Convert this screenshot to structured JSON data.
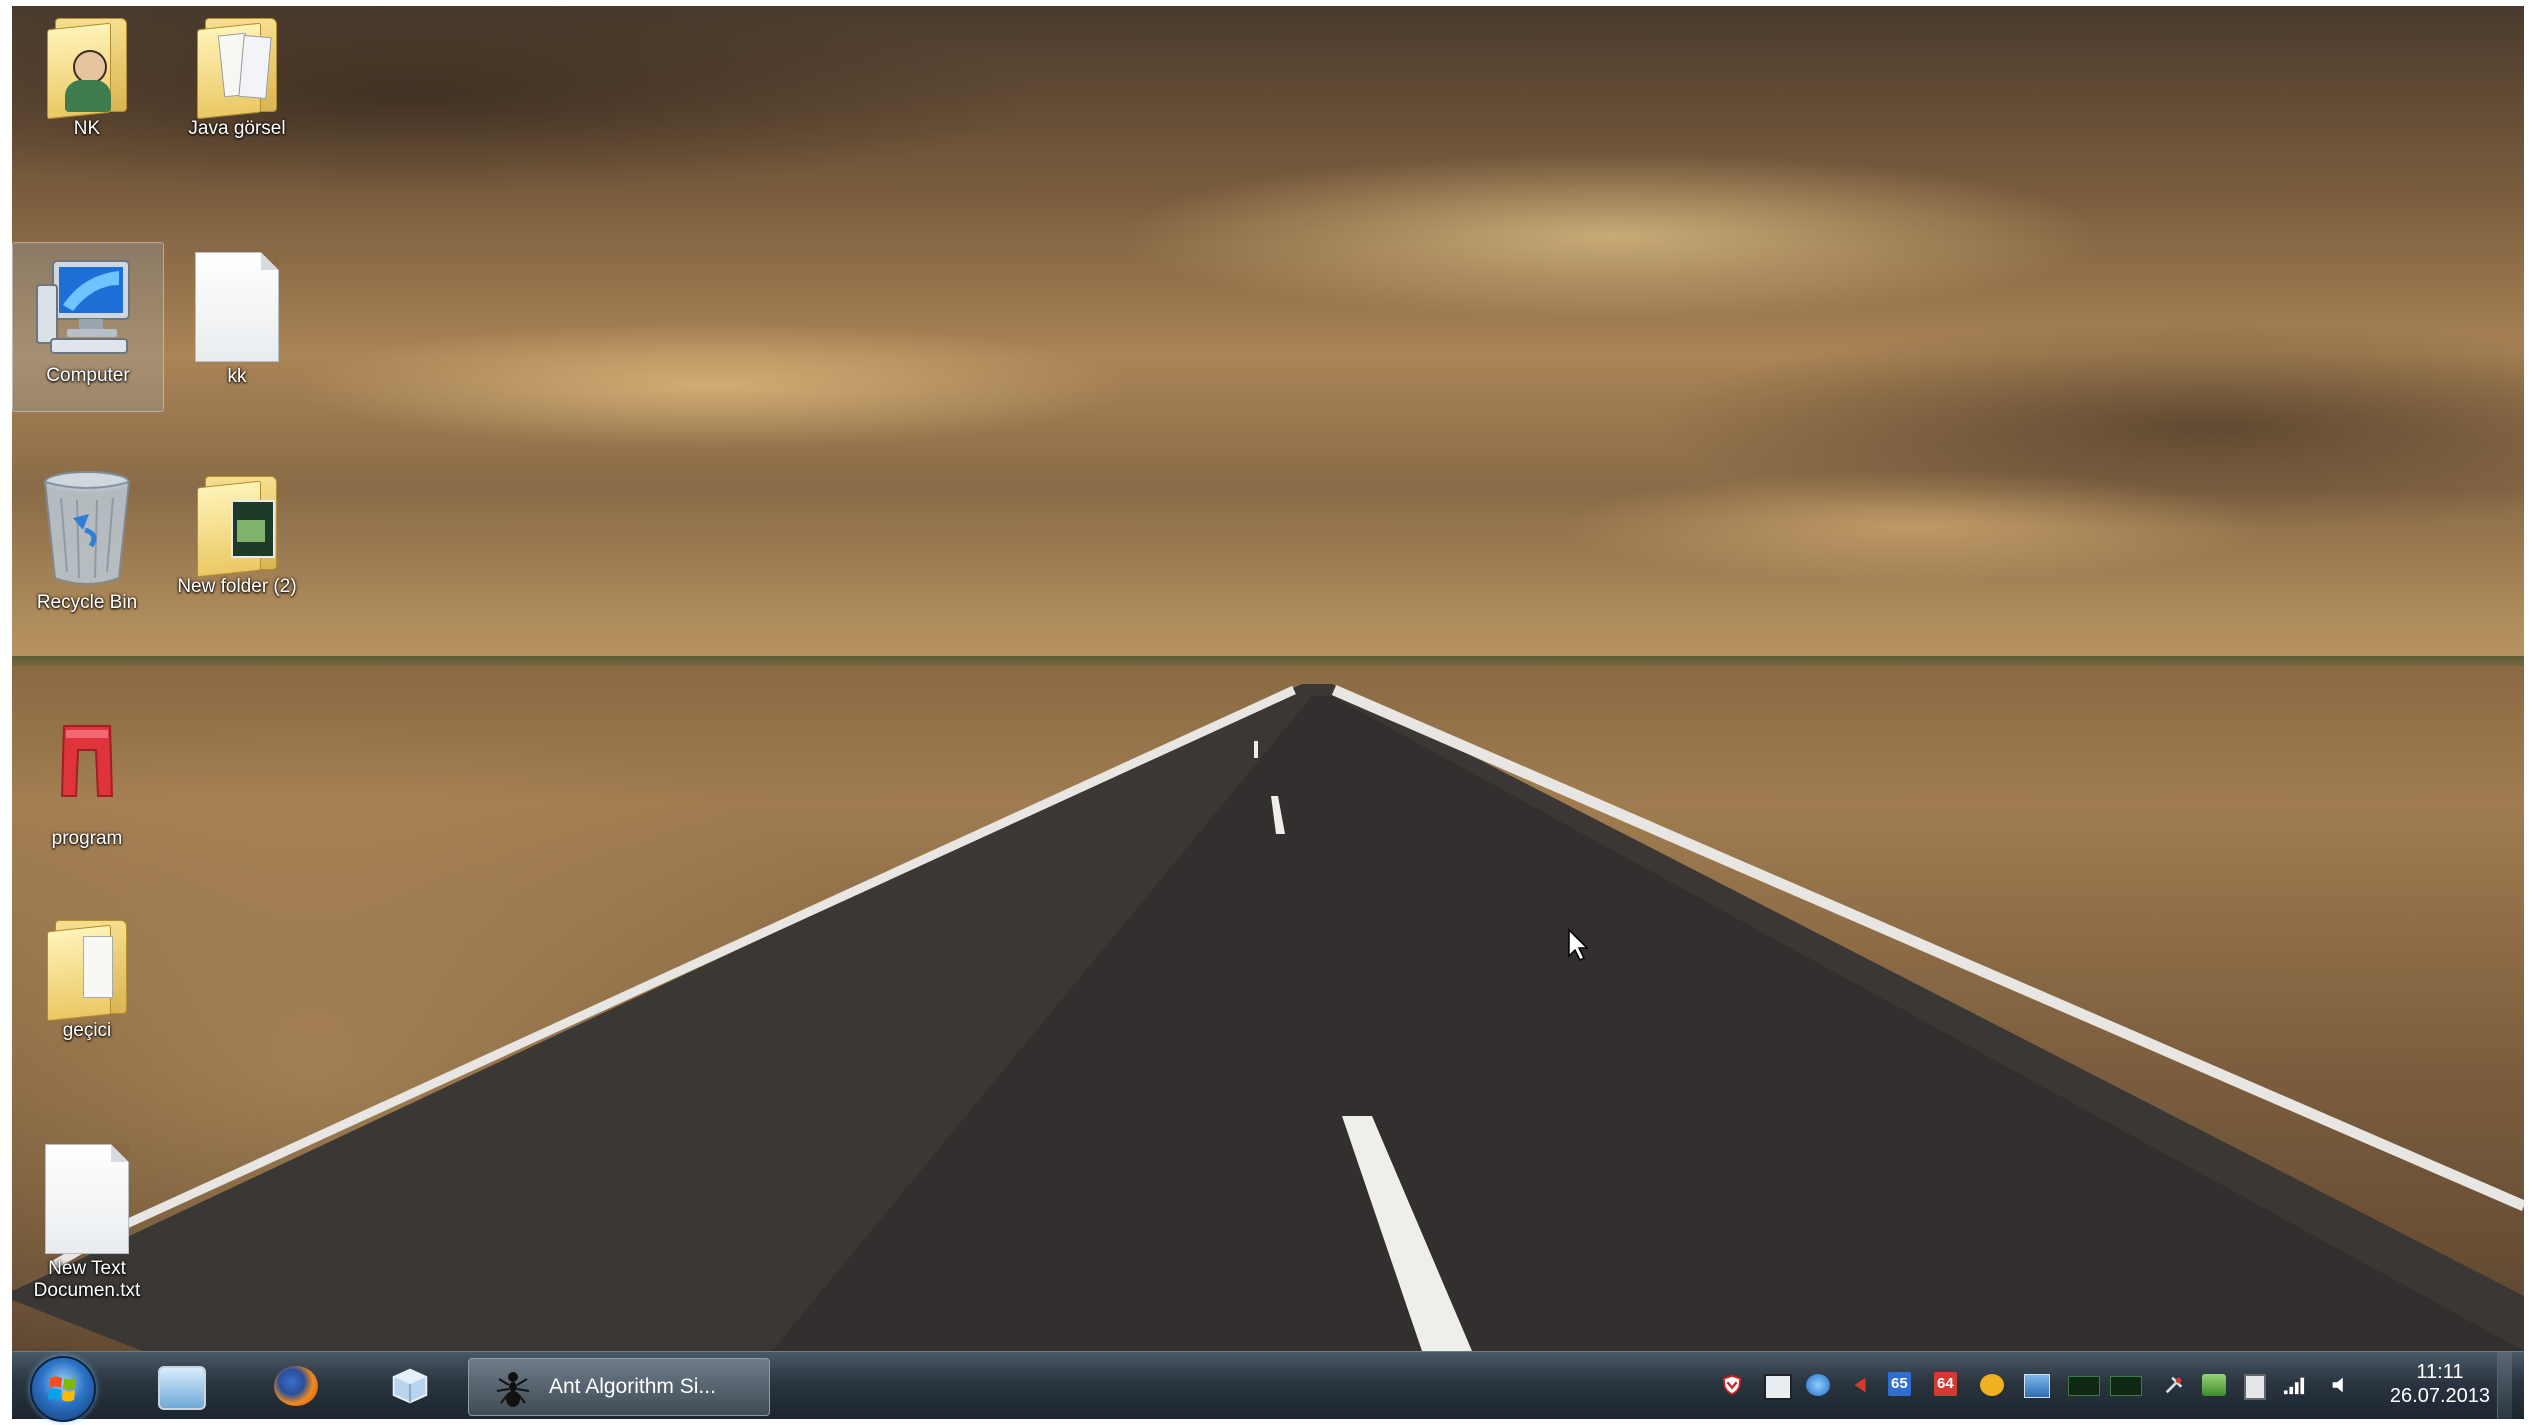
{
  "desktop_icons": [
    {
      "id": "nk",
      "label": "NK"
    },
    {
      "id": "java",
      "label": "Java görsel"
    },
    {
      "id": "computer",
      "label": "Computer"
    },
    {
      "id": "kk",
      "label": "kk"
    },
    {
      "id": "recycle",
      "label": "Recycle Bin"
    },
    {
      "id": "newfolder2",
      "label": "New folder (2)"
    },
    {
      "id": "program",
      "label": "program"
    },
    {
      "id": "gecici",
      "label": "geçici"
    },
    {
      "id": "newtext",
      "label": "New Text Documen.txt"
    }
  ],
  "taskbar": {
    "active_task_label": "Ant Algorithm Si...",
    "tray": {
      "badge_1": "65",
      "badge_2": "64"
    },
    "clock": {
      "time": "11:11",
      "date": "26.07.2013"
    }
  },
  "colors": {
    "taskbar": "#2a3540",
    "folder": "#eac864",
    "tray_badge_blue": "#2f6fd0",
    "tray_badge_red": "#d23a32"
  }
}
